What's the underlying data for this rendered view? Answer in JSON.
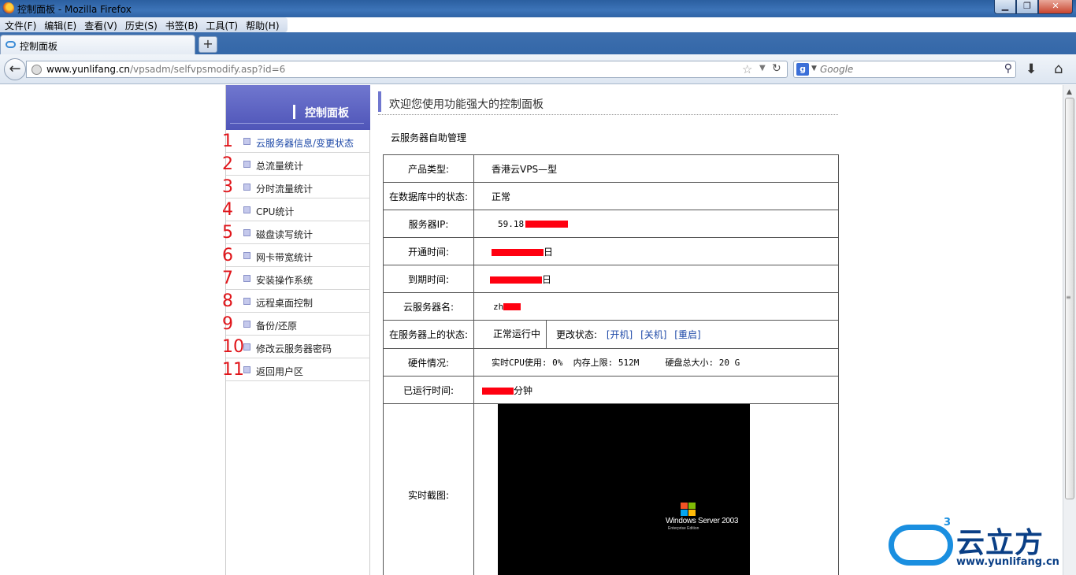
{
  "window": {
    "title": "控制面板 - Mozilla Firefox",
    "controls": {
      "minimize": "▁",
      "restore": "❐",
      "close": "✕"
    }
  },
  "menubar": [
    "文件(F)",
    "编辑(E)",
    "查看(V)",
    "历史(S)",
    "书签(B)",
    "工具(T)",
    "帮助(H)"
  ],
  "tab": {
    "label": "控制面板",
    "new_tab": "+"
  },
  "navbar": {
    "url_host": "www.yunlifang.cn",
    "url_path": "/vpsadm/selfvpsmodify.asp?id=6",
    "search_placeholder": "Google",
    "search_engine": "g"
  },
  "sidebar": {
    "title": "控制面板",
    "items": [
      {
        "num": "1",
        "label": "云服务器信息/变更状态"
      },
      {
        "num": "2",
        "label": "总流量统计"
      },
      {
        "num": "3",
        "label": "分时流量统计"
      },
      {
        "num": "4",
        "label": "CPU统计"
      },
      {
        "num": "5",
        "label": "磁盘读写统计"
      },
      {
        "num": "6",
        "label": "网卡带宽统计"
      },
      {
        "num": "7",
        "label": "安装操作系统"
      },
      {
        "num": "8",
        "label": "远程桌面控制"
      },
      {
        "num": "9",
        "label": "备份/还原"
      },
      {
        "num": "10",
        "label": "修改云服务器密码"
      },
      {
        "num": "11",
        "label": "返回用户区"
      }
    ]
  },
  "content": {
    "welcome": "欢迎您使用功能强大的控制面板",
    "subtitle": "云服务器自助管理",
    "rows": {
      "product_type": {
        "label": "产品类型:",
        "value": "香港云VPS—型"
      },
      "db_status": {
        "label": "在数据库中的状态:",
        "value": "正常"
      },
      "ip": {
        "label": "服务器IP:",
        "value": "59.18"
      },
      "open_time": {
        "label": "开通时间:",
        "value_suffix": "日"
      },
      "expire_time": {
        "label": "到期时间:",
        "value_suffix": "日"
      },
      "server_name": {
        "label": "云服务器名:",
        "value": "zh"
      },
      "server_status": {
        "label": "在服务器上的状态:",
        "value": "正常运行中",
        "change_label": "更改状态:",
        "actions": [
          "[开机]",
          "[关机]",
          "[重启]"
        ]
      },
      "hardware": {
        "label": "硬件情况:",
        "cpu": "实时CPU使用: 0%",
        "mem": "内存上限: 512M",
        "disk": "硬盘总大小: 20 G"
      },
      "uptime": {
        "label": "已运行时间:",
        "value_suffix": "分钟"
      },
      "screenshot": {
        "label": "实时截图:",
        "os_text": "Windows Server 2003",
        "os_edition": "Enterprise Edition"
      }
    }
  },
  "watermark": {
    "brand": "云立方",
    "site": "www.yunlifang.cn",
    "sup": "3"
  },
  "colors": {
    "accent": "#7077cf",
    "link": "#1f4aa8",
    "numbers": "#e0151a",
    "redaction": "#ff0010"
  }
}
